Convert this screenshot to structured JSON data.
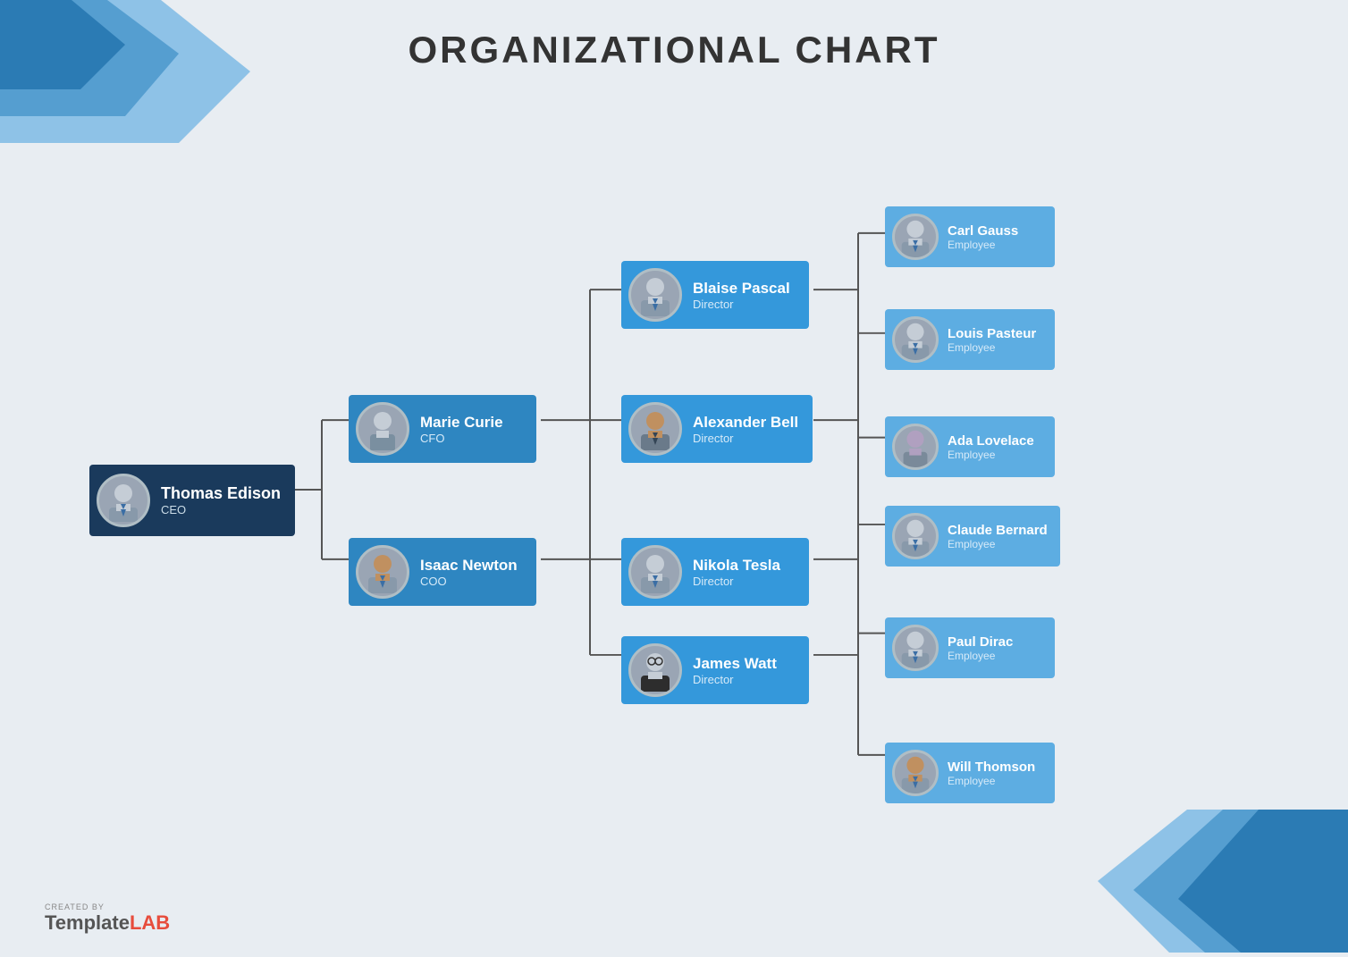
{
  "title": "ORGANIZATIONAL CHART",
  "colors": {
    "ceo_bg": "#1a3a5c",
    "mid_bg": "#2e86c1",
    "dir_bg": "#3498db",
    "emp_bg": "#5dade2",
    "line": "#555"
  },
  "footer": {
    "created_by": "CREATED BY",
    "brand_template": "Template",
    "brand_lab": "LAB"
  },
  "nodes": {
    "ceo": {
      "name": "Thomas Edison",
      "title": "CEO"
    },
    "mid": [
      {
        "name": "Marie Curie",
        "title": "CFO"
      },
      {
        "name": "Isaac Newton",
        "title": "COO"
      }
    ],
    "directors": [
      {
        "name": "Blaise Pascal",
        "title": "Director"
      },
      {
        "name": "Alexander Bell",
        "title": "Director"
      },
      {
        "name": "Nikola Tesla",
        "title": "Director"
      },
      {
        "name": "James Watt",
        "title": "Director"
      }
    ],
    "employees": [
      {
        "name": "Carl Gauss",
        "title": "Employee"
      },
      {
        "name": "Louis Pasteur",
        "title": "Employee"
      },
      {
        "name": "Ada Lovelace",
        "title": "Employee"
      },
      {
        "name": "Claude Bernard",
        "title": "Employee"
      },
      {
        "name": "Paul Dirac",
        "title": "Employee"
      },
      {
        "name": "Will Thomson",
        "title": "Employee"
      }
    ]
  }
}
